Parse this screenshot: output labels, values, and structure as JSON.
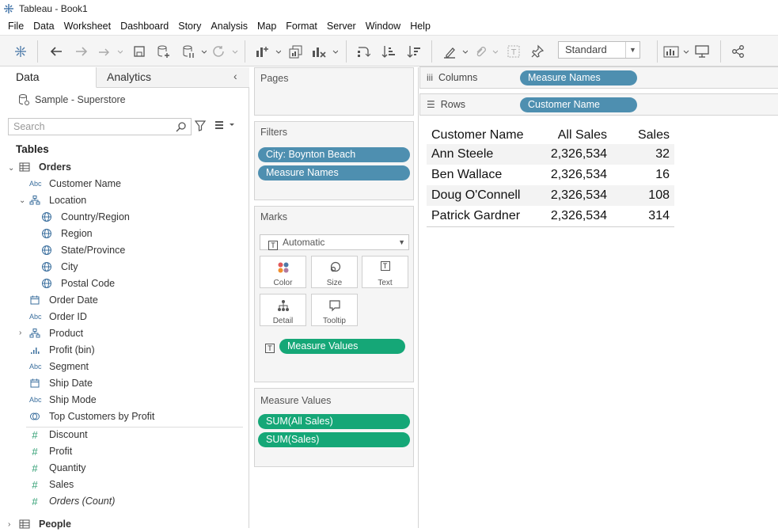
{
  "window": {
    "title": "Tableau - Book1"
  },
  "menu": [
    "File",
    "Data",
    "Worksheet",
    "Dashboard",
    "Story",
    "Analysis",
    "Map",
    "Format",
    "Server",
    "Window",
    "Help"
  ],
  "toolbar": {
    "fit_select": "Standard"
  },
  "data_pane": {
    "tab_data": "Data",
    "tab_analytics": "Analytics",
    "datasource": "Sample - Superstore",
    "search_placeholder": "Search",
    "tables_heading": "Tables",
    "orders_table": "Orders",
    "fields": {
      "customer_name": "Customer Name",
      "location": "Location",
      "country_region": "Country/Region",
      "region": "Region",
      "state_province": "State/Province",
      "city": "City",
      "postal_code": "Postal Code",
      "order_date": "Order Date",
      "order_id": "Order ID",
      "product": "Product",
      "profit_bin": "Profit (bin)",
      "segment": "Segment",
      "ship_date": "Ship Date",
      "ship_mode": "Ship Mode",
      "top_customers": "Top Customers by Profit",
      "discount": "Discount",
      "profit": "Profit",
      "quantity": "Quantity",
      "sales": "Sales",
      "orders_count": "Orders (Count)"
    },
    "people_table": "People",
    "type_labels": {
      "string": "Abc",
      "number": "#"
    }
  },
  "pages": {
    "title": "Pages"
  },
  "filters": {
    "title": "Filters",
    "items": [
      "City: Boynton Beach",
      "Measure Names"
    ]
  },
  "marks": {
    "title": "Marks",
    "type": "Automatic",
    "buttons": {
      "color": "Color",
      "size": "Size",
      "text": "Text",
      "detail": "Detail",
      "tooltip": "Tooltip"
    },
    "text_pill": "Measure Values"
  },
  "measure_values": {
    "title": "Measure Values",
    "items": [
      "SUM(All Sales)",
      "SUM(Sales)"
    ]
  },
  "columns": {
    "label": "Columns",
    "pill": "Measure Names"
  },
  "rows": {
    "label": "Rows",
    "pill": "Customer Name"
  },
  "view": {
    "headers": [
      "Customer Name",
      "All Sales",
      "Sales"
    ],
    "rows": [
      {
        "name": "Ann Steele",
        "all_sales": "2,326,534",
        "sales": "32"
      },
      {
        "name": "Ben Wallace",
        "all_sales": "2,326,534",
        "sales": "16"
      },
      {
        "name": "Doug O'Connell",
        "all_sales": "2,326,534",
        "sales": "108"
      },
      {
        "name": "Patrick Gardner",
        "all_sales": "2,326,534",
        "sales": "314"
      }
    ]
  },
  "colors": {
    "blue_pill": "#4e8fb0",
    "green_pill": "#15a777"
  }
}
